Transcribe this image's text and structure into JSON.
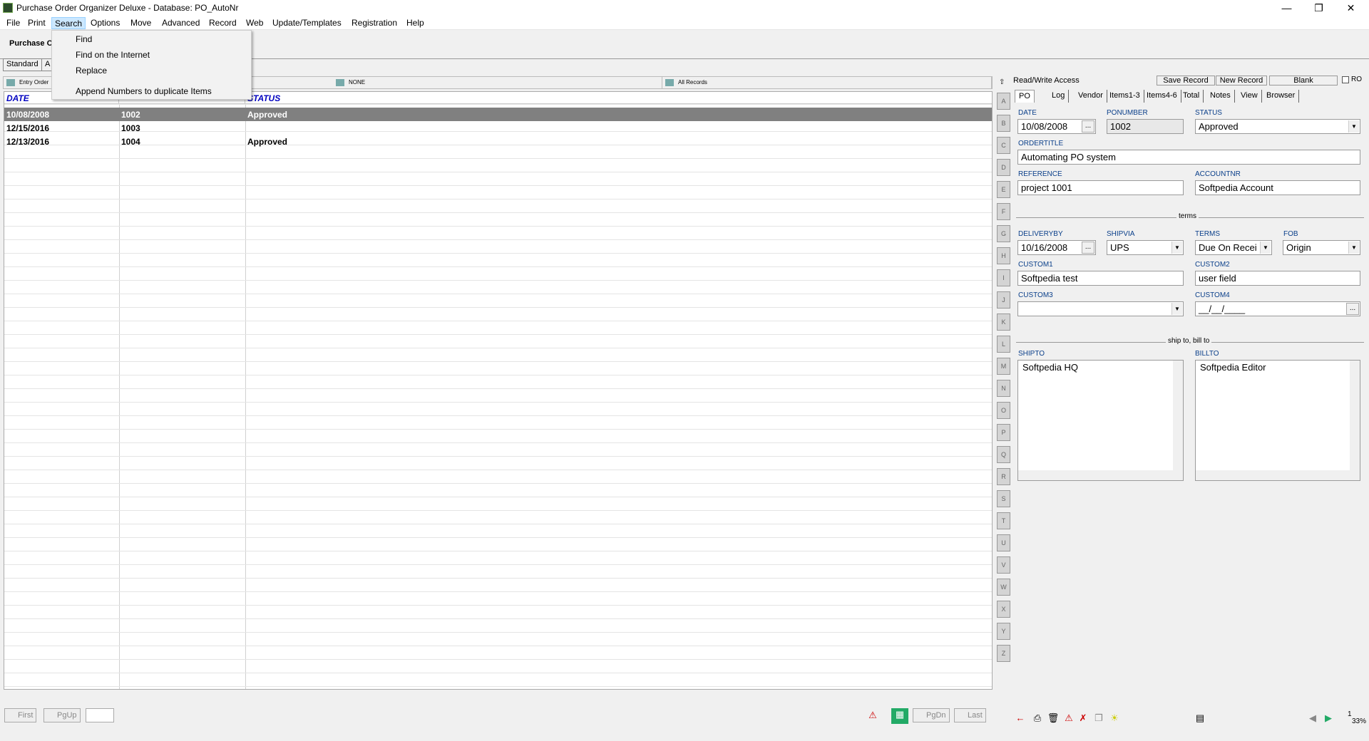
{
  "window": {
    "title": "Purchase Order Organizer Deluxe - Database: PO_AutoNr"
  },
  "menu": [
    "File",
    "Print",
    "Search",
    "Options",
    "Move",
    "Advanced",
    "Record",
    "Web",
    "Update/Templates",
    "Registration",
    "Help"
  ],
  "search_menu": [
    "Find",
    "Find on the Internet",
    "Replace",
    "Append Numbers to duplicate Items"
  ],
  "toolbar": {
    "section_label": "Purchase O",
    "standard_tab": "Standard",
    "second_tab": "A"
  },
  "filter": {
    "entry_order": "Entry Order",
    "none": "NONE",
    "all_records": "All Records"
  },
  "grid": {
    "headers": [
      "DATE",
      "",
      "STATUS"
    ],
    "rows": [
      {
        "date": "10/08/2008",
        "ponumber": "1002",
        "status": "Approved"
      },
      {
        "date": "12/15/2016",
        "ponumber": "1003",
        "status": ""
      },
      {
        "date": "12/13/2016",
        "ponumber": "1004",
        "status": "Approved"
      }
    ]
  },
  "alpha": [
    "A",
    "B",
    "C",
    "D",
    "E",
    "F",
    "G",
    "H",
    "I",
    "J",
    "K",
    "L",
    "M",
    "N",
    "O",
    "P",
    "Q",
    "R",
    "S",
    "T",
    "U",
    "V",
    "W",
    "X",
    "Y",
    "Z"
  ],
  "nav": {
    "first": "First",
    "pgup": "PgUp",
    "pgdn": "PgDn",
    "last": "Last"
  },
  "panel": {
    "access": "Read/Write Access",
    "save_record": "Save Record",
    "new_record": "New Record",
    "blank": "Blank",
    "ro": "RO",
    "tabs": [
      "PO",
      "Log",
      "Vendor",
      "Items1-3",
      "Items4-6",
      "Total",
      "Notes",
      "View",
      "Browser"
    ],
    "labels": {
      "date": "DATE",
      "ponumber": "PONUMBER",
      "status": "STATUS",
      "ordertitle": "ORDERTITLE",
      "reference": "REFERENCE",
      "accountnr": "ACCOUNTNR",
      "terms_sep": "terms",
      "deliveryby": "DELIVERYBY",
      "shipvia": "SHIPVIA",
      "terms": "TERMS",
      "fob": "FOB",
      "custom1": "CUSTOM1",
      "custom2": "CUSTOM2",
      "custom3": "CUSTOM3",
      "custom4": "CUSTOM4",
      "ship_sep": "ship to, bill to",
      "shipto": "SHIPTO",
      "billto": "BILLTO"
    },
    "values": {
      "date": "10/08/2008",
      "ponumber": "1002",
      "status": "Approved",
      "ordertitle": "Automating PO system",
      "reference": "project 1001",
      "accountnr": "Softpedia Account",
      "deliveryby": "10/16/2008",
      "shipvia": "UPS",
      "terms": "Due On Recei",
      "fob": "Origin",
      "custom1": "Softpedia test",
      "custom2": "user field",
      "custom3": "",
      "custom4": "__/__/____",
      "shipto": "Softpedia HQ",
      "billto": "Softpedia Editor"
    }
  },
  "status": {
    "zoom": "33%",
    "page": "1"
  }
}
